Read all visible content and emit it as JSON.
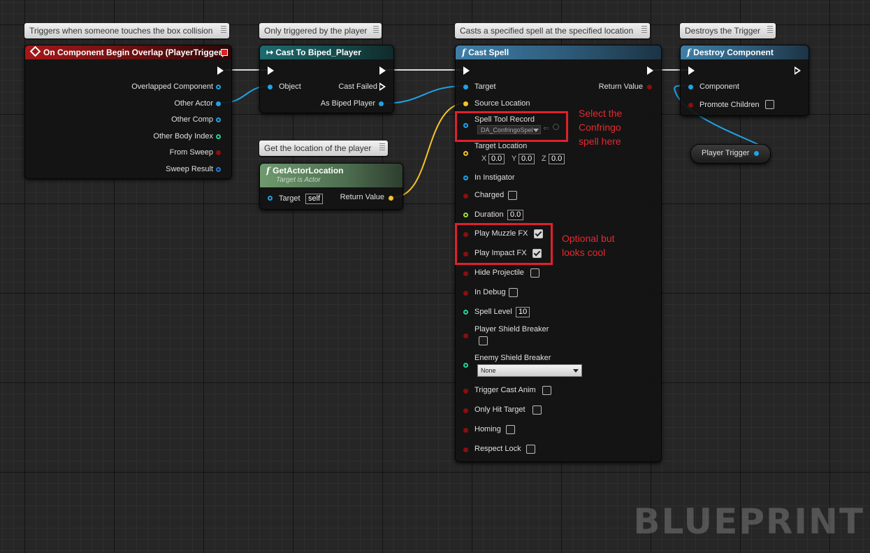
{
  "comments": {
    "overlap": "Triggers when someone touches the box collision",
    "cast_to": "Only triggered by the player",
    "cast_spell": "Casts a specified spell at the specified location",
    "destroy": "Destroys the Trigger",
    "get_location": "Get the location of the player"
  },
  "overlap_node": {
    "title": "On Component Begin Overlap (PlayerTrigger)",
    "pins": [
      "Overlapped Component",
      "Other Actor",
      "Other Comp",
      "Other Body Index",
      "From Sweep",
      "Sweep Result"
    ]
  },
  "cast_node": {
    "title": "Cast To Biped_Player",
    "object": "Object",
    "cast_failed": "Cast Failed",
    "as_biped": "As Biped Player"
  },
  "get_location_node": {
    "title": "GetActorLocation",
    "subtitle": "Target is Actor",
    "target": "Target",
    "self": "self",
    "return_value": "Return Value"
  },
  "cast_spell_node": {
    "title": "Cast Spell",
    "target": "Target",
    "return_value": "Return Value",
    "source_location": "Source Location",
    "spell_tool_record": "Spell Tool Record",
    "spell_tool_value": "DA_ConfringoSpel",
    "target_location": "Target Location",
    "vector": {
      "x_label": "X",
      "x": "0.0",
      "y_label": "Y",
      "y": "0.0",
      "z_label": "Z",
      "z": "0.0"
    },
    "in_instigator": "In Instigator",
    "charged": "Charged",
    "duration": "Duration",
    "duration_value": "0.0",
    "play_muzzle_fx": "Play Muzzle FX",
    "play_impact_fx": "Play Impact FX",
    "hide_projectile": "Hide Projectile",
    "in_debug": "In Debug",
    "spell_level": "Spell Level",
    "spell_level_value": "10",
    "player_shield_breaker": "Player Shield Breaker",
    "enemy_shield_breaker": "Enemy Shield Breaker",
    "enemy_shield_value": "None",
    "trigger_cast_anim": "Trigger Cast Anim",
    "only_hit_target": "Only Hit Target",
    "homing": "Homing",
    "respect_lock": "Respect Lock"
  },
  "destroy_node": {
    "title": "Destroy Component",
    "component": "Component",
    "promote_children": "Promote Children"
  },
  "player_trigger": "Player Trigger",
  "annotations": {
    "spell_note": [
      "Select the",
      "Confringo",
      "spell here"
    ],
    "fx_note": [
      "Optional but",
      "looks cool"
    ]
  },
  "watermark": "BLUEPRINT",
  "colors": {
    "exec": "#ffffff",
    "object_pin": "#1fa3e6",
    "vector_pin": "#f6c32a",
    "bool_pin": "#8b0e0e",
    "int_pin": "#1fd39a",
    "float_pin": "#9ade3c",
    "annotation": "#e0202c"
  }
}
